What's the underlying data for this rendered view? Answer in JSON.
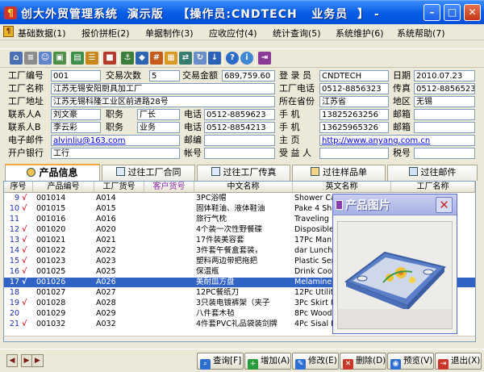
{
  "window": {
    "title": "创大外贸管理系统  演示版   【操作员:CNDTECH   业务员  】 -"
  },
  "menu": [
    "基础数据(1)",
    "报价拼柜(2)",
    "单据制作(3)",
    "应收应付(4)",
    "统计查询(5)",
    "系统维护(6)",
    "系统帮助(7)"
  ],
  "toolbar_icons": [
    "home-icon",
    "database-icon",
    "users-icon",
    "image-icon",
    "chart-icon",
    "list-icon",
    "cube-icon",
    "ship-icon",
    "cart-icon",
    "calc-icon",
    "grid-icon",
    "swap-icon",
    "help-icon",
    "info-icon",
    "exit-icon"
  ],
  "info": {
    "labels": {
      "factory_no": "工厂编号",
      "trade_count": "交易次数",
      "trade_amount": "交易金额",
      "login": "登 录 员",
      "date": "日期",
      "factory_name": "工厂名称",
      "factory_phone": "工厂电话",
      "fax": "传真",
      "factory_addr": "工厂地址",
      "province": "所在省份",
      "region": "地区",
      "contact_a": "联系人A",
      "post_a": "职务",
      "phone_a": "电话",
      "mobile_a": "手 机",
      "email_a": "邮箱",
      "contact_b": "联系人B",
      "post_b": "职务",
      "phone_b": "电话",
      "mobile_b": "手 机",
      "email_b": "邮箱",
      "email": "电子邮件",
      "mail": "邮编",
      "homepage": "主 页",
      "bank": "开户银行",
      "account": "帐号",
      "beneficiary": "受 益 人",
      "tax": "税号"
    },
    "values": {
      "factory_no": "001",
      "trade_count": "5",
      "trade_amount": "689,759.60",
      "login": "CNDTECH",
      "date": "2010.07.23",
      "factory_name": "江苏无锡安阳厨具加工厂",
      "factory_phone": "0512-8856323",
      "fax": "0512-8856523",
      "factory_addr": "江苏无锡科隆工业区前进路28号",
      "province": "江苏省",
      "region": "无锡",
      "contact_a": "刘文豪",
      "post_a": "厂长",
      "phone_a": "0512-8859623",
      "mobile_a": "13825263256",
      "email_a": "",
      "contact_b": "李云彩",
      "post_b": "业务",
      "phone_b": "0512-8854213",
      "mobile_b": "13625965326",
      "email_b": "",
      "email": "alvinliu@163.com",
      "mail": "",
      "homepage": "http://www.anyang.com.cn",
      "bank": "工行",
      "account": "",
      "beneficiary": "",
      "tax": ""
    }
  },
  "tabs": [
    "产品信息",
    "过往工厂合同",
    "过往工厂传真",
    "过往样品单",
    "过往邮件"
  ],
  "table": {
    "columns": [
      "序号",
      "产品编号",
      "工厂货号",
      "客户货号",
      "中文名称",
      "英文名称",
      "工厂名称"
    ],
    "rows": [
      {
        "no": "9",
        "chk": "√",
        "code": "001014",
        "fno": "A014",
        "cno": "",
        "cn": "3PC浴帽",
        "en": "Shower Cap"
      },
      {
        "no": "10",
        "chk": "√",
        "code": "001015",
        "fno": "A015",
        "cno": "",
        "cn": "固体鞋油、液体鞋油",
        "en": "Pake 4 Shoe"
      },
      {
        "no": "11",
        "chk": "",
        "code": "001016",
        "fno": "A016",
        "cno": "",
        "cn": "旅行气枕",
        "en": "Traveling Pi"
      },
      {
        "no": "12",
        "chk": "√",
        "code": "001020",
        "fno": "A020",
        "cno": "",
        "cn": "4个装一次性野餐碟",
        "en": "Disposible F"
      },
      {
        "no": "13",
        "chk": "√",
        "code": "001021",
        "fno": "A021",
        "cno": "",
        "cn": "17件装美容套",
        "en": "17Pc Manicu"
      },
      {
        "no": "14",
        "chk": "√",
        "code": "001022",
        "fno": "A022",
        "cno": "",
        "cn": "3件套午餐盒套装，",
        "en": "dar Lunch Kit 3P"
      },
      {
        "no": "15",
        "chk": "√",
        "code": "001023",
        "fno": "A023",
        "cno": "",
        "cn": "塑料两边带把拖把",
        "en": "Plastic Servi"
      },
      {
        "no": "16",
        "chk": "√",
        "code": "001025",
        "fno": "A025",
        "cno": "",
        "cn": "保温瓶",
        "en": "Drink Coolei"
      },
      {
        "no": "17",
        "chk": "√",
        "code": "001026",
        "fno": "A026",
        "cno": "",
        "cn": "美耐皿方盘",
        "en": "Melamine Sq"
      },
      {
        "no": "18",
        "chk": "",
        "code": "001027",
        "fno": "A027",
        "cno": "",
        "cn": "12PC餐纸刀",
        "en": "12Pc Utility"
      },
      {
        "no": "19",
        "chk": "√",
        "code": "001028",
        "fno": "A028",
        "cno": "",
        "cn": "3只装电镀裤架（夹子",
        "en": "3Pc Skirt Ho"
      },
      {
        "no": "20",
        "chk": "",
        "code": "001029",
        "fno": "A029",
        "cno": "",
        "cn": "八件套木毡",
        "en": "8Pc Wood D"
      },
      {
        "no": "21",
        "chk": "√",
        "code": "001032",
        "fno": "A032",
        "cno": "",
        "cn": "4件套PVC礼品袋装剑牌",
        "en": "4Pc Sisal Ba"
      }
    ],
    "selected_row": 8
  },
  "popup": {
    "title": "产品图片"
  },
  "bottom_buttons": [
    {
      "label": "查询[F]",
      "icon": "search-icon",
      "color": "#2d6fd1"
    },
    {
      "label": "增加(A)",
      "icon": "add-icon",
      "color": "#2a9b3a"
    },
    {
      "label": "修改(E)",
      "icon": "edit-icon",
      "color": "#2d6fd1"
    },
    {
      "label": "删除(D)",
      "icon": "delete-icon",
      "color": "#c8372a"
    },
    {
      "label": "预览(V)",
      "icon": "preview-icon",
      "color": "#2d6fd1"
    },
    {
      "label": "退出(X)",
      "icon": "exit-icon",
      "color": "#c8372a"
    }
  ]
}
